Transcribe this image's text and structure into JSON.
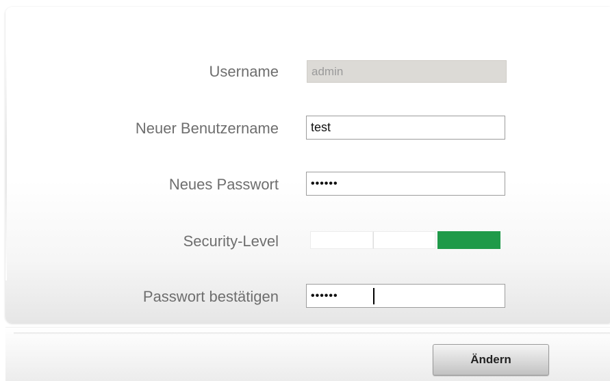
{
  "form": {
    "username_label": "Username",
    "username_value": "admin",
    "new_username_label": "Neuer Benutzername",
    "new_username_value": "test",
    "new_password_label": "Neues Passwort",
    "new_password_value": "••••••",
    "security_level_label": "Security-Level",
    "security_level": {
      "segments": 3,
      "active_segment": 3,
      "active_color": "#1f9a49"
    },
    "confirm_password_label": "Passwort bestätigen",
    "confirm_password_value": "••••••"
  },
  "actions": {
    "submit_label": "Ändern"
  }
}
